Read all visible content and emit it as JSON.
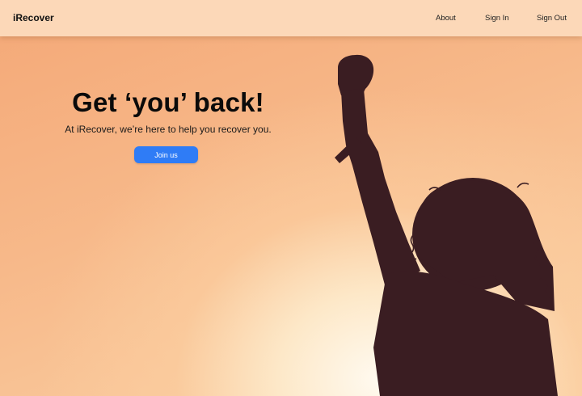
{
  "navbar": {
    "brand": "iRecover",
    "links": [
      {
        "label": "About"
      },
      {
        "label": "Sign In"
      },
      {
        "label": "Sign Out"
      }
    ]
  },
  "hero": {
    "headline": "Get ‘you’ back!",
    "subline": "At iRecover, we’re here to help you recover you.",
    "cta_label": "Join us",
    "image": "silhouette-raised-fist"
  },
  "colors": {
    "cta": "#2f7cf6",
    "navbar": "#fcd8b8",
    "silhouette": "#3a1d22"
  }
}
